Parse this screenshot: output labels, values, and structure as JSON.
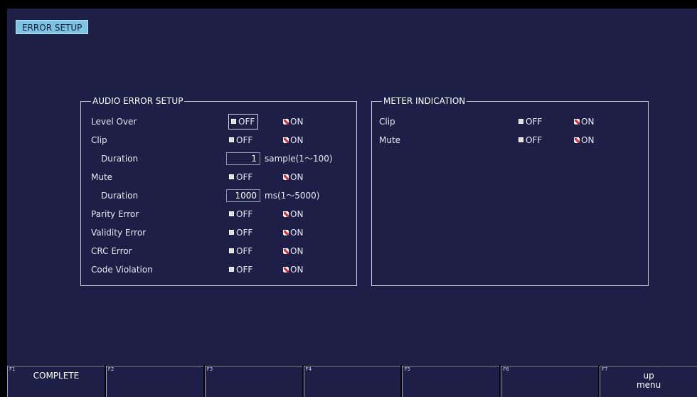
{
  "title": "ERROR SETUP",
  "audio_panel": {
    "title": "AUDIO ERROR SETUP",
    "rows": [
      {
        "label": "Level Over",
        "off": "OFF",
        "on": "ON"
      },
      {
        "label": "Clip",
        "off": "OFF",
        "on": "ON"
      },
      {
        "label": "Duration",
        "value": "1",
        "unit": "sample(1～100)"
      },
      {
        "label": "Mute",
        "off": "OFF",
        "on": "ON"
      },
      {
        "label": "Duration",
        "value": "1000",
        "unit": "ms(1～5000)"
      },
      {
        "label": "Parity Error",
        "off": "OFF",
        "on": "ON"
      },
      {
        "label": "Validity Error",
        "off": "OFF",
        "on": "ON"
      },
      {
        "label": "CRC Error",
        "off": "OFF",
        "on": "ON"
      },
      {
        "label": "Code Violation",
        "off": "OFF",
        "on": "ON"
      }
    ]
  },
  "meter_panel": {
    "title": "METER INDICATION",
    "rows": [
      {
        "label": "Clip",
        "off": "OFF",
        "on": "ON"
      },
      {
        "label": "Mute",
        "off": "OFF",
        "on": "ON"
      }
    ]
  },
  "fkeys": [
    {
      "num": "F1",
      "label": "COMPLETE"
    },
    {
      "num": "F2",
      "label": ""
    },
    {
      "num": "F3",
      "label": ""
    },
    {
      "num": "F4",
      "label": ""
    },
    {
      "num": "F5",
      "label": ""
    },
    {
      "num": "F6",
      "label": ""
    },
    {
      "num": "F7",
      "label": "up\nmenu"
    }
  ],
  "colors": {
    "background": "#1d1f47",
    "title_tab": "#7ec3e2",
    "on_check": "#d2303a"
  },
  "icons": {
    "off_box": "square-checkbox-unchecked-icon",
    "on_box": "square-checkbox-checked-icon"
  }
}
